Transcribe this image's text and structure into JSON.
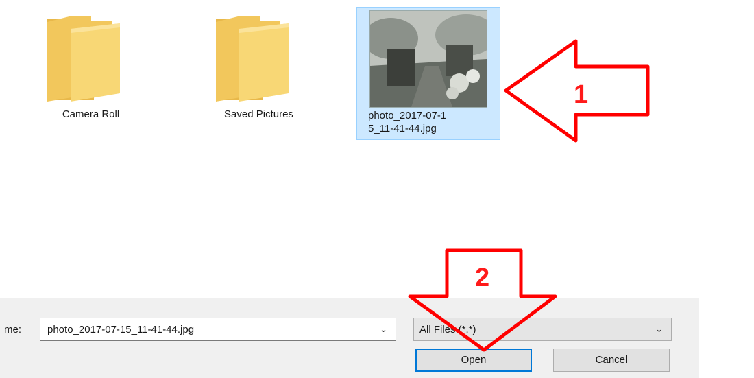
{
  "files": [
    {
      "name": "Camera Roll",
      "type": "folder"
    },
    {
      "name": "Saved Pictures",
      "type": "folder"
    },
    {
      "name": "photo_2017-07-1\n5_11-41-44.jpg",
      "type": "image",
      "selected": true
    }
  ],
  "dialog": {
    "filename_label": "me:",
    "filename_value": "photo_2017-07-15_11-41-44.jpg",
    "filetype_value": "All Files (*.*)",
    "open_label": "Open",
    "cancel_label": "Cancel"
  },
  "annotations": {
    "step1": "1",
    "step2": "2",
    "color": "#ff0000"
  },
  "colors": {
    "selection_bg": "#cce8ff",
    "selection_border": "#99d1ff",
    "accent": "#0078d7",
    "folder": "#f8d775"
  }
}
